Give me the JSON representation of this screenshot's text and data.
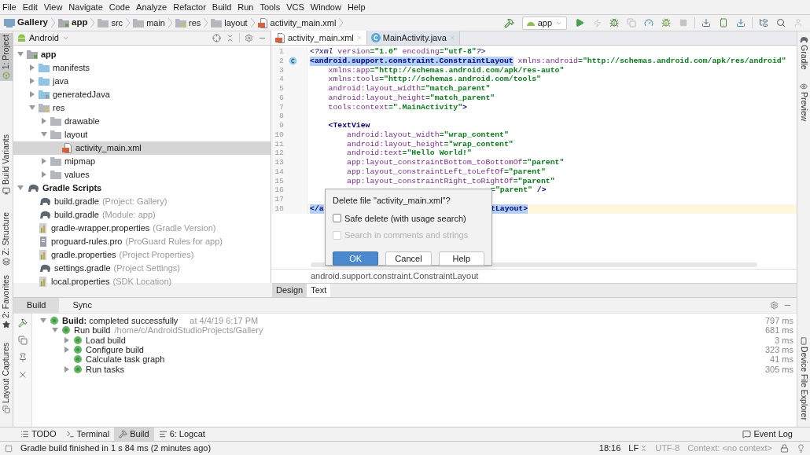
{
  "menu": [
    "File",
    "Edit",
    "View",
    "Navigate",
    "Code",
    "Analyze",
    "Refactor",
    "Build",
    "Run",
    "Tools",
    "VCS",
    "Window",
    "Help"
  ],
  "breadcrumb": [
    {
      "label": "Gallery",
      "kind": "project"
    },
    {
      "label": "app",
      "kind": "module"
    },
    {
      "label": "src",
      "kind": "folder"
    },
    {
      "label": "main",
      "kind": "folder"
    },
    {
      "label": "res",
      "kind": "res"
    },
    {
      "label": "layout",
      "kind": "folder"
    },
    {
      "label": "activity_main.xml",
      "kind": "xml"
    }
  ],
  "run_config": "app",
  "left_strip": [
    {
      "label": "1: Project",
      "selected": true
    },
    {
      "label": "Build Variants",
      "selected": false
    },
    {
      "label": "Z: Structure",
      "selected": false
    },
    {
      "label": "2: Favorites",
      "selected": false
    },
    {
      "label": "Layout Captures",
      "selected": false
    }
  ],
  "right_strip": [
    "Gradle",
    "Preview",
    "Device File Explorer"
  ],
  "project": {
    "view": "Android",
    "tree": [
      {
        "label": "app",
        "kind": "module",
        "expanded": true,
        "selected": false,
        "children": [
          {
            "label": "manifests",
            "kind": "folder-blue",
            "expanded": false,
            "selected": false
          },
          {
            "label": "java",
            "kind": "folder-blue",
            "expanded": false,
            "selected": false
          },
          {
            "label": "generatedJava",
            "kind": "folder-gen",
            "expanded": false,
            "selected": false
          },
          {
            "label": "res",
            "kind": "folder-res",
            "expanded": true,
            "selected": false,
            "children": [
              {
                "label": "drawable",
                "kind": "folder",
                "expanded": false,
                "selected": false
              },
              {
                "label": "layout",
                "kind": "folder",
                "expanded": true,
                "selected": false,
                "children": [
                  {
                    "label": "activity_main.xml",
                    "kind": "xml",
                    "selected": true
                  }
                ]
              },
              {
                "label": "mipmap",
                "kind": "folder",
                "expanded": false,
                "selected": false
              },
              {
                "label": "values",
                "kind": "folder",
                "expanded": false,
                "selected": false
              }
            ]
          }
        ]
      },
      {
        "label": "Gradle Scripts",
        "kind": "gradle",
        "expanded": true,
        "selected": false,
        "children": [
          {
            "label": "build.gradle",
            "note": "(Project: Gallery)",
            "kind": "gradle",
            "selected": false
          },
          {
            "label": "build.gradle",
            "note": "(Module: app)",
            "kind": "gradle",
            "selected": false
          },
          {
            "label": "gradle-wrapper.properties",
            "note": "(Gradle Version)",
            "kind": "properties",
            "selected": false
          },
          {
            "label": "proguard-rules.pro",
            "note": "(ProGuard Rules for app)",
            "kind": "pro",
            "selected": false
          },
          {
            "label": "gradle.properties",
            "note": "(Project Properties)",
            "kind": "properties",
            "selected": false
          },
          {
            "label": "settings.gradle",
            "note": "(Project Settings)",
            "kind": "gradle",
            "selected": false
          },
          {
            "label": "local.properties",
            "note": "(SDK Location)",
            "kind": "properties",
            "selected": false
          }
        ]
      }
    ]
  },
  "editor": {
    "tabs": [
      {
        "label": "activity_main.xml",
        "kind": "xml",
        "selected": true
      },
      {
        "label": "MainActivity.java",
        "kind": "class",
        "selected": false
      }
    ],
    "lines": [
      {
        "no": "1",
        "current": false,
        "marker": false,
        "before": [
          {
            "t": "<?xml",
            "kind": "pi"
          },
          {
            "t": " version",
            "kind": "attr"
          },
          {
            "t": "=\"1.0\"",
            "kind": "value"
          },
          {
            "t": " encoding",
            "kind": "attr"
          },
          {
            "t": "=\"utf-8\"",
            "kind": "value"
          },
          {
            "t": "?>",
            "kind": "pi"
          }
        ]
      },
      {
        "no": "2",
        "current": false,
        "marker": true,
        "before": [
          {
            "t": "<android.support.constraint.ConstraintLayout",
            "kind": "tag-selected"
          },
          {
            "t": " xmlns:android",
            "kind": "attr"
          },
          {
            "t": "=\"http://schemas.android.com/apk/res/android\"",
            "kind": "value"
          }
        ]
      },
      {
        "no": "3",
        "current": false,
        "marker": false,
        "before": [
          {
            "t": "    xmlns:app",
            "kind": "attr"
          },
          {
            "t": "=\"http://schemas.android.com/apk/res-auto\"",
            "kind": "value"
          }
        ]
      },
      {
        "no": "4",
        "current": false,
        "marker": false,
        "before": [
          {
            "t": "    xmlns:tools",
            "kind": "attr"
          },
          {
            "t": "=\"http://schemas.android.com/tools\"",
            "kind": "value"
          }
        ]
      },
      {
        "no": "5",
        "current": false,
        "marker": false,
        "before": [
          {
            "t": "    android:layout_width",
            "kind": "attr"
          },
          {
            "t": "=\"match_parent\"",
            "kind": "value"
          }
        ]
      },
      {
        "no": "6",
        "current": false,
        "marker": false,
        "before": [
          {
            "t": "    android:layout_height",
            "kind": "attr"
          },
          {
            "t": "=\"match_parent\"",
            "kind": "value"
          }
        ]
      },
      {
        "no": "7",
        "current": false,
        "marker": false,
        "before": [
          {
            "t": "    tools:context",
            "kind": "attr"
          },
          {
            "t": "=\".MainActivity\"",
            "kind": "value"
          },
          {
            "t": ">",
            "kind": "tag"
          }
        ]
      },
      {
        "no": "8",
        "current": false,
        "marker": false
      },
      {
        "no": "9",
        "current": false,
        "marker": false,
        "before": [
          {
            "t": "    <TextView",
            "kind": "tag"
          }
        ]
      },
      {
        "no": "10",
        "current": false,
        "marker": false,
        "before": [
          {
            "t": "        android:layout_width",
            "kind": "attr"
          },
          {
            "t": "=\"wrap_content\"",
            "kind": "value"
          }
        ]
      },
      {
        "no": "11",
        "current": false,
        "marker": false,
        "before": [
          {
            "t": "        android:layout_height",
            "kind": "attr"
          },
          {
            "t": "=\"wrap_content\"",
            "kind": "value"
          }
        ]
      },
      {
        "no": "12",
        "current": false,
        "marker": false,
        "before": [
          {
            "t": "        android:text",
            "kind": "attr"
          },
          {
            "t": "=\"Hello World!\"",
            "kind": "value"
          }
        ]
      },
      {
        "no": "13",
        "current": false,
        "marker": false,
        "before": [
          {
            "t": "        app:layout_constraintBottom_toBottomOf",
            "kind": "attr"
          },
          {
            "t": "=\"parent\"",
            "kind": "value"
          }
        ]
      },
      {
        "no": "14",
        "current": false,
        "marker": false,
        "before": [
          {
            "t": "        app:layout_constraintLeft_toLeftOf",
            "kind": "attr"
          },
          {
            "t": "=\"parent\"",
            "kind": "value"
          }
        ]
      },
      {
        "no": "15",
        "current": false,
        "marker": false,
        "before": [
          {
            "t": "        app:layout_constraintRight_toRightOf",
            "kind": "attr"
          },
          {
            "t": "=\"parent\"",
            "kind": "value"
          }
        ]
      },
      {
        "no": "16",
        "current": false,
        "marker": false,
        "after": [
          {
            "t": "=\"parent\"",
            "kind": "value"
          },
          {
            "t": " />",
            "kind": "tag"
          }
        ]
      },
      {
        "no": "17",
        "current": false,
        "marker": false
      },
      {
        "no": "18",
        "current": true,
        "marker": false,
        "before": [
          {
            "t": "</a",
            "kind": "tag-selected"
          }
        ],
        "after": [
          {
            "t": "tLayout>",
            "kind": "tag-selected"
          }
        ]
      }
    ],
    "path": "android.support.constraint.ConstraintLayout",
    "mode_tabs": [
      {
        "label": "Design",
        "selected": false
      },
      {
        "label": "Text",
        "selected": true
      }
    ]
  },
  "dialog": {
    "title": "Delete file \"activity_main.xml\"?",
    "options": [
      {
        "label": "Safe delete (with usage search)",
        "checked": false,
        "disabled": false
      },
      {
        "label": "Search in comments and strings",
        "checked": false,
        "disabled": true
      }
    ],
    "buttons": [
      {
        "label": "OK",
        "default": true
      },
      {
        "label": "Cancel",
        "default": false
      },
      {
        "label": "Help",
        "default": false
      }
    ]
  },
  "build_panel": {
    "tabs": [
      {
        "label": "Build",
        "selected": true
      },
      {
        "label": "Sync",
        "selected": false
      }
    ],
    "tree": [
      {
        "label": "**Build:** completed successfully",
        "note": "at 4/4/19 6:17 PM",
        "time": "797 ms",
        "expanded": true,
        "children": [
          {
            "label": "Run build",
            "note": "/home/c/AndroidStudioProjects/Gallery",
            "time": "681 ms",
            "expanded": true,
            "children": [
              {
                "label": "Load build",
                "time": "3 ms",
                "expanded": false
              },
              {
                "label": "Configure build",
                "time": "323 ms",
                "expanded": false
              },
              {
                "label": "Calculate task graph",
                "time": "41 ms"
              },
              {
                "label": "Run tasks",
                "time": "305 ms",
                "expanded": false
              }
            ]
          }
        ]
      }
    ]
  },
  "tool_tabs": [
    {
      "label": "TODO",
      "kind": "todo",
      "selected": false
    },
    {
      "label": "Terminal",
      "kind": "terminal",
      "selected": false
    },
    {
      "label": "Build",
      "kind": "build",
      "selected": true
    },
    {
      "label": "6: Logcat",
      "kind": "logcat",
      "selected": false
    }
  ],
  "event_log": "Event Log",
  "status_bar": {
    "message": "Gradle build finished in 1 s 84 ms (2 minutes ago)",
    "position": "18:16",
    "line_sep": "LF",
    "encoding": "UTF-8",
    "context": "Context: <no context>"
  }
}
